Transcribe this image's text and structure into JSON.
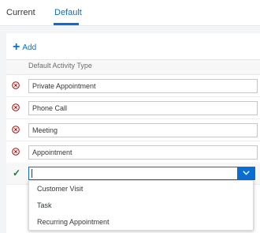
{
  "tabs": {
    "current_label": "Current",
    "default_label": "Default"
  },
  "toolbar": {
    "add_label": "Add"
  },
  "table": {
    "column_header": "Default Activity Type",
    "rows": [
      {
        "value": "Private Appointment"
      },
      {
        "value": "Phone Call"
      },
      {
        "value": "Meeting"
      },
      {
        "value": "Appointment"
      }
    ],
    "new_row_value": ""
  },
  "dropdown": {
    "options": [
      {
        "label": "Customer Visit"
      },
      {
        "label": "Task"
      },
      {
        "label": "Recurring Appointment"
      }
    ]
  },
  "colors": {
    "accent": "#0a6ed1",
    "delete": "#bb0000",
    "confirm": "#107e3e"
  },
  "icons": {
    "add": "plus-icon",
    "delete": "delete-circle-icon",
    "confirm": "checkmark-icon",
    "dropdown": "chevron-down-icon"
  }
}
